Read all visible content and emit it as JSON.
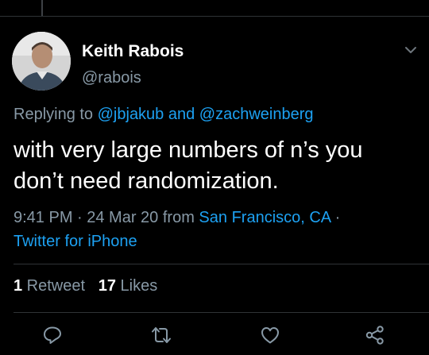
{
  "tweet": {
    "author_name": "Keith Rabois",
    "author_handle": "@rabois",
    "replying_prefix": "Replying to ",
    "replying_user1": "@jbjakub",
    "replying_and": " and ",
    "replying_user2": "@zachweinberg",
    "text": "with very large numbers of n’s you don’t need randomization.",
    "time_date": "9:41 PM · 24 Mar 20 from ",
    "location": "San Francisco, CA",
    "separator": " · ",
    "client": "Twitter for iPhone"
  },
  "stats": {
    "retweets_count": "1",
    "retweets_label": " Retweet",
    "likes_count": "17",
    "likes_label": " Likes"
  },
  "icons": {
    "reply": "reply-icon",
    "retweet": "retweet-icon",
    "like": "heart-icon",
    "share": "share-icon",
    "menu": "chevron-down-icon"
  },
  "colors": {
    "background": "#000000",
    "text_primary": "#ffffff",
    "text_secondary": "#8899a6",
    "link": "#1da1f2",
    "divider": "#2f3336"
  }
}
